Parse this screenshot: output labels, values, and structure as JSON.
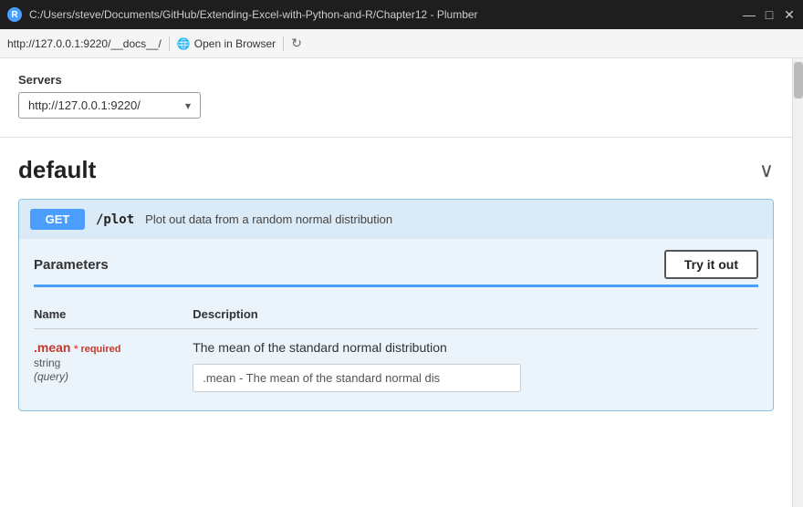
{
  "titlebar": {
    "icon_label": "R",
    "path": "C:/Users/steve/Documents/GitHub/Extending-Excel-with-Python-and-R/Chapter12 - Plumber",
    "controls": {
      "minimize": "—",
      "maximize": "□",
      "close": "✕"
    }
  },
  "addressbar": {
    "url": "http://127.0.0.1:9220/__docs__/",
    "open_browser_label": "Open in Browser",
    "refresh_icon": "↻"
  },
  "servers": {
    "label": "Servers",
    "selected": "http://127.0.0.1:9220/",
    "arrow": "▾"
  },
  "default_section": {
    "title": "default",
    "chevron": "∨"
  },
  "endpoint": {
    "method": "GET",
    "path": "/plot",
    "description": "Plot out data from a random normal distribution"
  },
  "parameters": {
    "title": "Parameters",
    "try_it_label": "Try it out",
    "name_col": "Name",
    "description_col": "Description",
    "params": [
      {
        "name": ".mean",
        "required_star": "*",
        "required_label": "required",
        "type": "string",
        "location": "(query)",
        "description": "The mean of the standard normal distribution",
        "placeholder": ".mean - The mean of the standard normal dis"
      }
    ]
  }
}
